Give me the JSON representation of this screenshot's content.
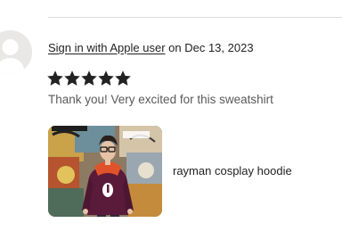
{
  "review": {
    "reviewer_name": "Sign in with Apple user",
    "date_prefix": " on ",
    "date": "Dec 13, 2023",
    "rating": 5,
    "rating_max": 5,
    "text": "Thank you! Very excited for this sweatshirt",
    "item": {
      "title": "rayman cosplay hoodie"
    }
  },
  "icons": {
    "avatar": "default-user-avatar-icon",
    "star": "star-filled-icon"
  },
  "colors": {
    "text_primary": "#222222",
    "text_secondary": "#595959",
    "star": "#222222",
    "hoodie": "#5a1a3a",
    "hood_lining": "#e0532a"
  }
}
